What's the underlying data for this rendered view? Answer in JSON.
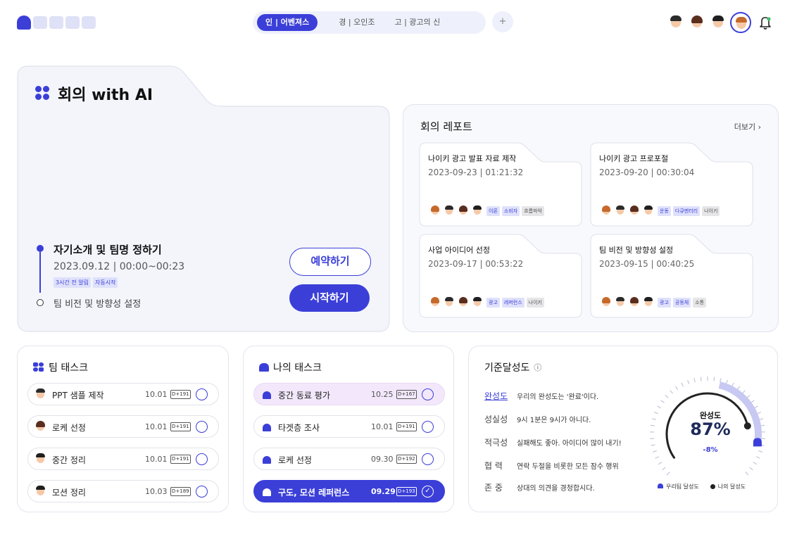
{
  "header": {
    "tabs": [
      {
        "label": "인 | 어벤져스",
        "active": true
      },
      {
        "label": "경 | 오인조",
        "active": false
      },
      {
        "label": "고 | 광고의 신",
        "active": false
      }
    ],
    "add_label": "+",
    "avatar_count": 4
  },
  "ai_meeting": {
    "title": "회의 with AI",
    "event1": {
      "title": "자기소개 및 팀명 정하기",
      "time": "2023.09.12 | 00:00~00:23",
      "tags": [
        "3시간 전 알림",
        "자동시작"
      ]
    },
    "event2": {
      "title": "팀 비전 및 방향성 설정"
    },
    "reserve_label": "예약하기",
    "start_label": "시작하기"
  },
  "report": {
    "title": "회의 레포트",
    "more": "더보기 ›",
    "cards": [
      {
        "title": "나이키 광고 발표 자료 제작",
        "time": "2023-09-23 | 01:21:32",
        "tags": [
          "이론",
          "소비자",
          "흐름파악"
        ]
      },
      {
        "title": "나이키 광고 프로포절",
        "time": "2023-09-20 | 00:30:04",
        "tags": [
          "운동",
          "다큐멘터리",
          "나이키"
        ]
      },
      {
        "title": "사업 아이디어 선정",
        "time": "2023-09-17 | 00:53:22",
        "tags": [
          "광고",
          "레퍼런스",
          "나이키"
        ]
      },
      {
        "title": "팀 비전 및 방향성 설정",
        "time": "2023-09-15 | 00:40:25",
        "tags": [
          "광고",
          "공동체",
          "소통"
        ]
      }
    ]
  },
  "team_tasks": {
    "title": "팀 태스크",
    "items": [
      {
        "name": "PPT 샘플 제작",
        "date": "10.01",
        "dday": "D+191"
      },
      {
        "name": "로케 선정",
        "date": "10.01",
        "dday": "D+191"
      },
      {
        "name": "중간 정리",
        "date": "10.01",
        "dday": "D+191"
      },
      {
        "name": "모션 정리",
        "date": "10.03",
        "dday": "D+189"
      }
    ]
  },
  "my_tasks": {
    "title": "나의 태스크",
    "items": [
      {
        "name": "중간 동료 평가",
        "date": "10.25",
        "dday": "D+167",
        "state": "pink"
      },
      {
        "name": "타겟층 조사",
        "date": "10.01",
        "dday": "D+191",
        "state": "normal"
      },
      {
        "name": "로케 선정",
        "date": "09.30",
        "dday": "D+192",
        "state": "normal"
      },
      {
        "name": "구도, 모션 레퍼런스",
        "date": "09.29",
        "dday": "D+193",
        "state": "done"
      }
    ]
  },
  "achievement": {
    "title": "기준달성도",
    "info_icon": "ⓘ",
    "criteria": [
      {
        "key": "완성도",
        "value": "우리의 완성도는 '완료'이다."
      },
      {
        "key": "성실성",
        "value": "9시 1분은 9시가 아니다."
      },
      {
        "key": "적극성",
        "value": "실패해도 좋아. 아이디어 많이 내기!"
      },
      {
        "key": "협 력",
        "value": "연락 두절을 비롯한 모든 잠수 행위"
      },
      {
        "key": "존 중",
        "value": "상대의 의견을 경청합시다."
      }
    ],
    "gauge": {
      "label": "완성도",
      "value_text": "87%",
      "diff_text": "-8%",
      "team_value": 87,
      "mine_value": 79
    },
    "legend": {
      "team": "우리팀 달성도",
      "mine": "나의 달성도"
    },
    "colors": {
      "team": "#3b3fd8",
      "mine": "#222222"
    }
  }
}
